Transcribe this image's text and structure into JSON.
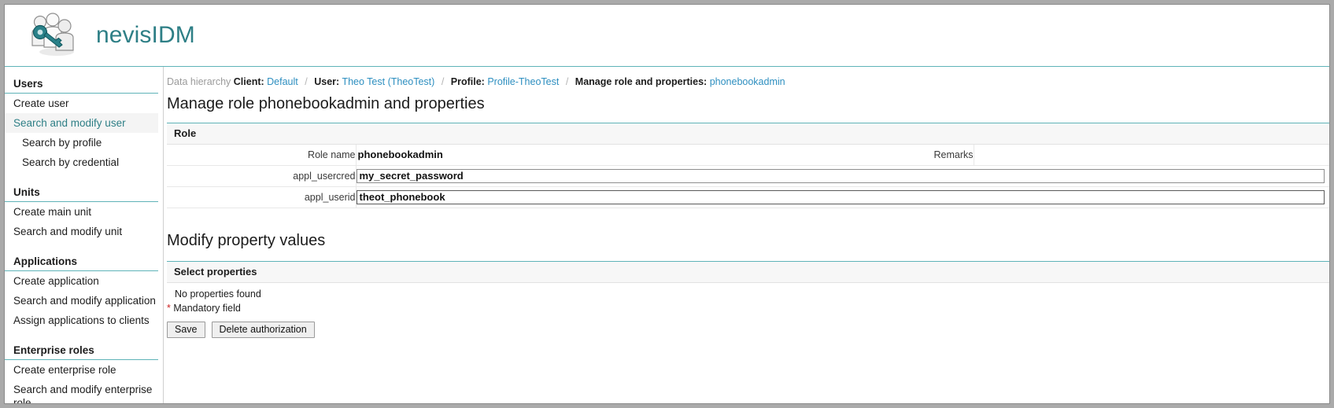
{
  "brand": {
    "title": "nevisIDM",
    "logo_icon": "users-key-icon",
    "accent_color": "#2e7f86",
    "rule_color": "#5fb3b8"
  },
  "sidebar": {
    "groups": [
      {
        "title": "Users",
        "items": [
          {
            "label": "Create user",
            "active": false,
            "sub": false
          },
          {
            "label": "Search and modify user",
            "active": true,
            "sub": false
          },
          {
            "label": "Search by profile",
            "active": false,
            "sub": true
          },
          {
            "label": "Search by credential",
            "active": false,
            "sub": true
          }
        ]
      },
      {
        "title": "Units",
        "items": [
          {
            "label": "Create main unit",
            "active": false,
            "sub": false
          },
          {
            "label": "Search and modify unit",
            "active": false,
            "sub": false
          }
        ]
      },
      {
        "title": "Applications",
        "items": [
          {
            "label": "Create application",
            "active": false,
            "sub": false
          },
          {
            "label": "Search and modify application",
            "active": false,
            "sub": false
          },
          {
            "label": "Assign applications to clients",
            "active": false,
            "sub": false
          }
        ]
      },
      {
        "title": "Enterprise roles",
        "items": [
          {
            "label": "Create enterprise role",
            "active": false,
            "sub": false
          },
          {
            "label": "Search and modify enterprise role",
            "active": false,
            "sub": false
          }
        ]
      }
    ]
  },
  "breadcrumb": {
    "root": "Data hierarchy",
    "crumbs": [
      {
        "label": "Client:",
        "value": "Default"
      },
      {
        "label": "User:",
        "value": "Theo Test (TheoTest)"
      },
      {
        "label": "Profile:",
        "value": "Profile-TheoTest"
      },
      {
        "label": "Manage role and properties:",
        "value": "phonebookadmin"
      }
    ],
    "separator": "/"
  },
  "main": {
    "page_title": "Manage role phonebookadmin and properties",
    "section_title": "Modify property values",
    "role_panel": {
      "heading": "Role",
      "rows": [
        {
          "label": "Role name",
          "value": "phonebookadmin",
          "type": "text",
          "remarks_label": "Remarks",
          "remarks_value": ""
        },
        {
          "label": "appl_usercred",
          "value": "my_secret_password",
          "type": "input",
          "focused": false
        },
        {
          "label": "appl_userid",
          "value": "theot_phonebook",
          "type": "input",
          "focused": true
        }
      ]
    },
    "properties_panel": {
      "heading": "Select properties",
      "empty_message": "No properties found",
      "mandatory_star": "*",
      "mandatory_text": "Mandatory field"
    },
    "buttons": {
      "save": "Save",
      "delete": "Delete authorization"
    }
  }
}
